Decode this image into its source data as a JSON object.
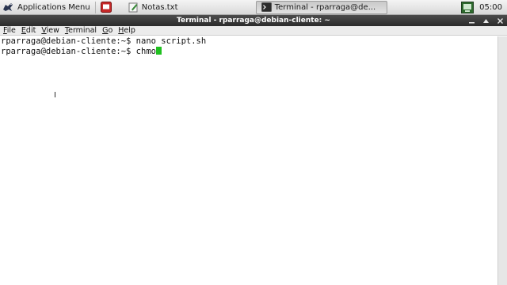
{
  "panel": {
    "apps_menu_label": "Applications Menu",
    "tasks": [
      {
        "label": "Notas.txt",
        "icon": "text-editor-icon"
      },
      {
        "label": "Terminal - rparraga@de...",
        "icon": "terminal-icon"
      }
    ],
    "clock": "05:00"
  },
  "window": {
    "title": "Terminal - rparraga@debian-cliente: ~",
    "controls": [
      "minimize",
      "maximize",
      "close"
    ]
  },
  "menubar": {
    "items": [
      "File",
      "Edit",
      "View",
      "Terminal",
      "Go",
      "Help"
    ]
  },
  "terminal": {
    "lines": [
      "rparraga@debian-cliente:~$ nano script.sh",
      "rparraga@debian-cliente:~$ chmo"
    ],
    "cursor_color": "#20c020"
  },
  "colors": {
    "panel_bg": "#dedede",
    "titlebar_bg": "#333333",
    "terminal_bg": "#ffffff"
  }
}
